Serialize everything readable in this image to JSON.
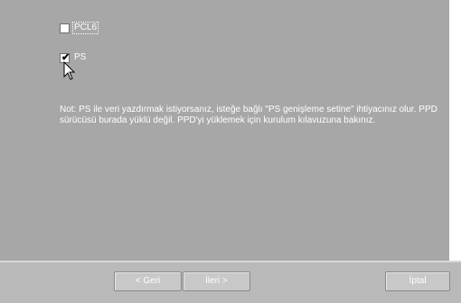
{
  "options": {
    "pcl6": {
      "label": "PCL6",
      "checked": false
    },
    "ps": {
      "label": "PS",
      "checked": true,
      "check_glyph": "✔"
    }
  },
  "note": "Not: PS ile veri yazdırmak istiyorsanız, isteğe bağlı \"PS genişleme setine\" ihtiyacınız olur. PPD sürücüsü burada yüklü değil. PPD'yi yüklemek için kurulum kılavuzuna bakınız.",
  "buttons": {
    "back": "< Geri",
    "next": "İleri >",
    "cancel": "İptal"
  },
  "icons": {
    "cursor": "mouse-pointer-icon"
  },
  "colors": {
    "panel": "#a7a7a7",
    "text": "#ffffff",
    "button_face": "#c8c8c8"
  }
}
